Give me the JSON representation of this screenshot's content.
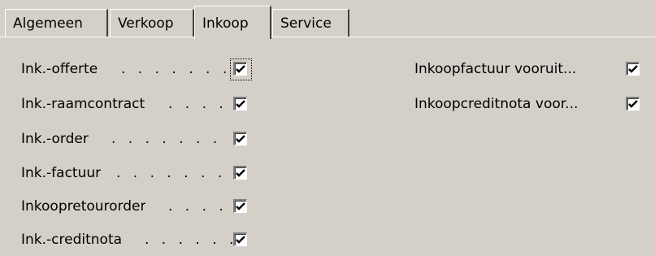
{
  "tabs": [
    {
      "label": "Algemeen",
      "active": false
    },
    {
      "label": "Verkoop",
      "active": false
    },
    {
      "label": "Inkoop",
      "active": true
    },
    {
      "label": "Service",
      "active": false
    }
  ],
  "left_fields": [
    {
      "label": "Ink.-offerte",
      "dots": ". . . . . . .",
      "checked": true,
      "focused": true
    },
    {
      "label": "Ink.-raamcontract",
      "dots": ". . . .",
      "checked": true
    },
    {
      "label": "Ink.-order",
      "dots": ". . . . . . .",
      "checked": true
    },
    {
      "label": "Ink.-factuur",
      "dots": ". . . . . . .",
      "checked": true
    },
    {
      "label": "Inkoopretourorder",
      "dots": ". . . .",
      "checked": true
    },
    {
      "label": "Ink.-creditnota",
      "dots": ". . . . . .",
      "checked": true
    }
  ],
  "right_fields": [
    {
      "label": "Inkoopfactuur vooruit...",
      "checked": true
    },
    {
      "label": "Inkoopcreditnota voor...",
      "checked": true
    }
  ]
}
